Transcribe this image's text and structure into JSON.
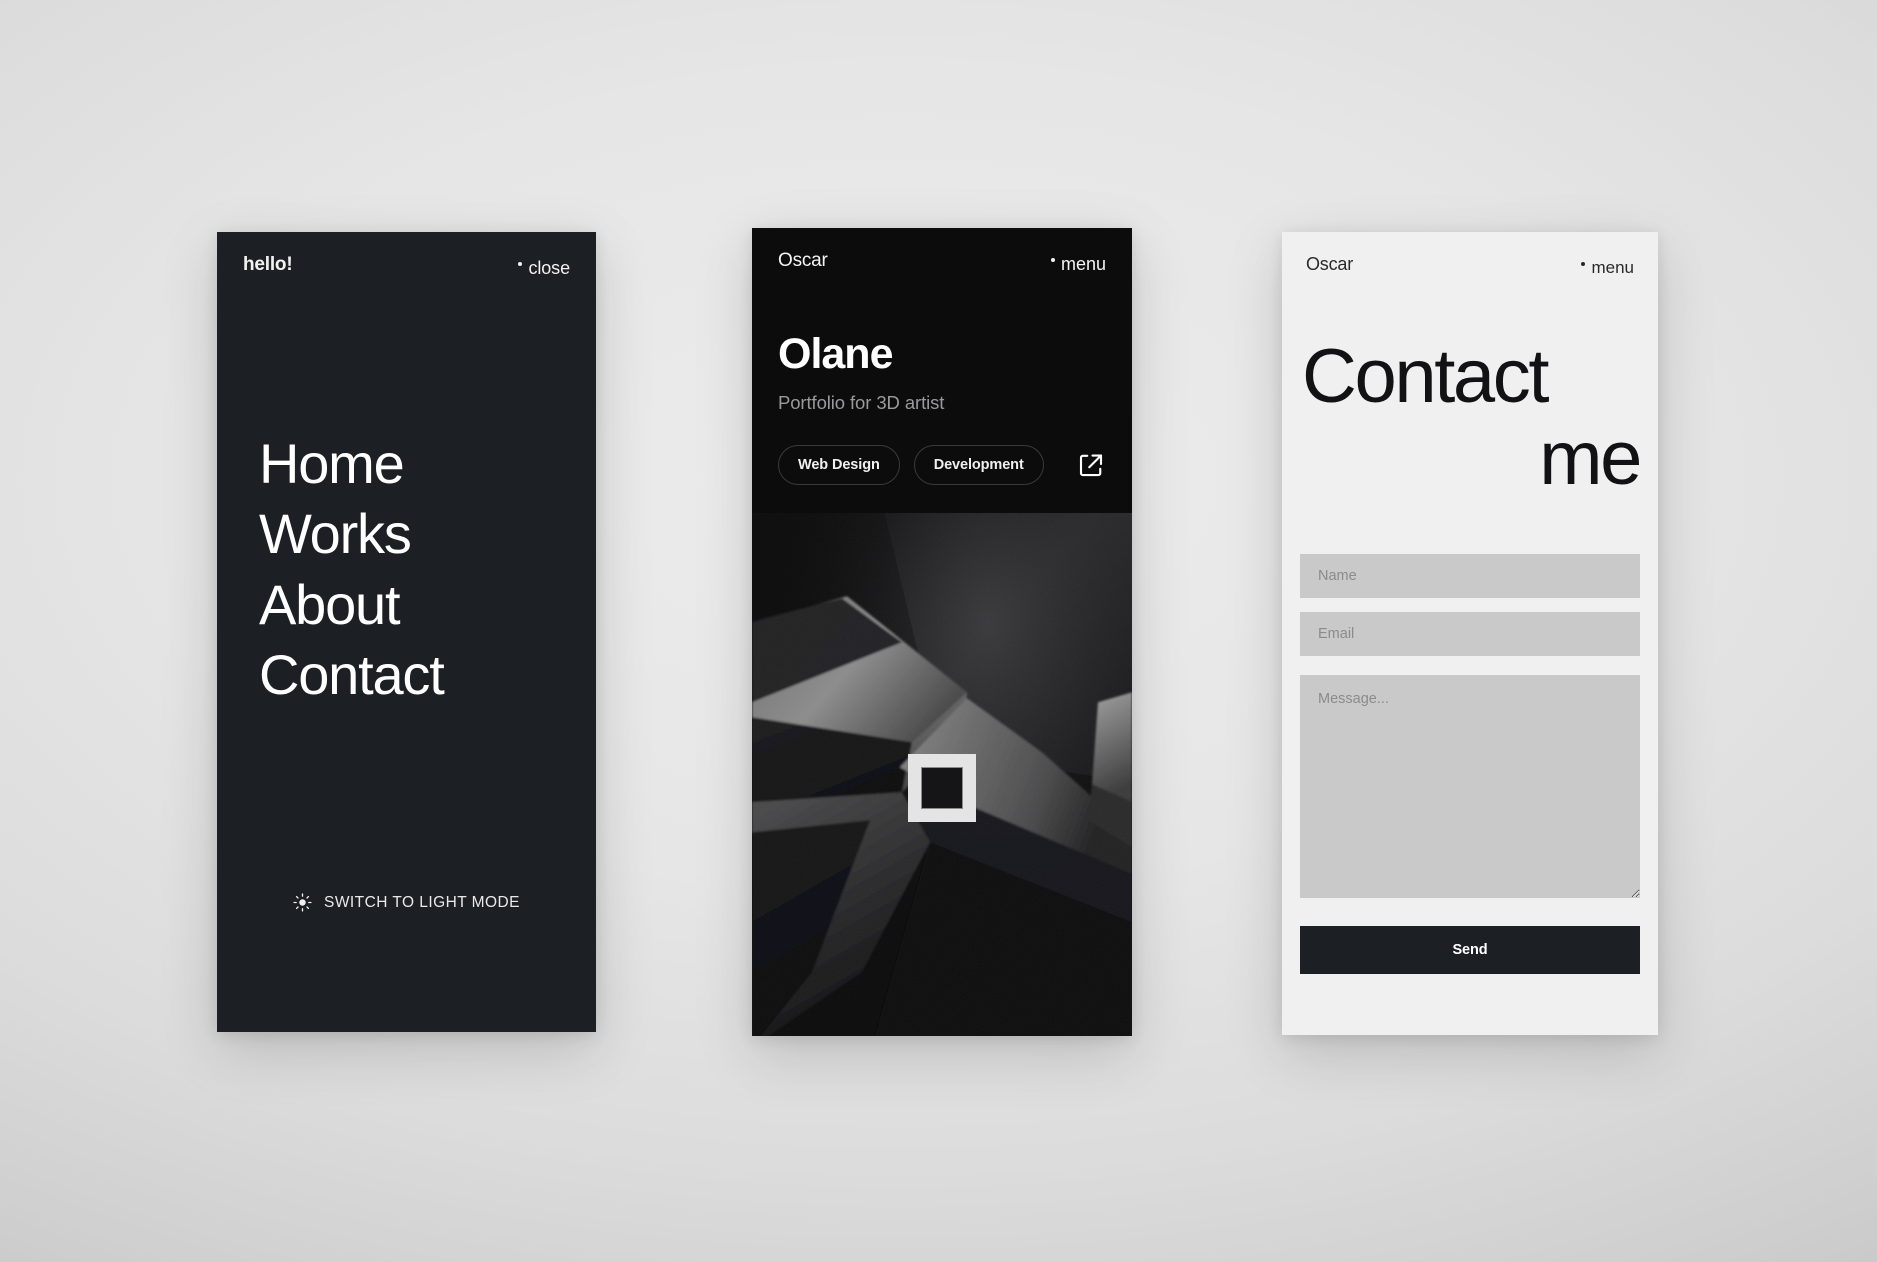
{
  "background": {
    "base_color": "#e6e6e6",
    "edge_color": "#c6c6c6"
  },
  "screens": [
    {
      "id": "menu",
      "theme": "dark",
      "background_color": "#1c1f23",
      "topbar": {
        "brand": "hello!",
        "action": "close",
        "bullet": "•"
      },
      "nav_items": [
        {
          "label": "Home"
        },
        {
          "label": "Works"
        },
        {
          "label": "About"
        },
        {
          "label": "Contact"
        }
      ],
      "theme_toggle": {
        "icon": "sun-icon",
        "label": "SWITCH TO LIGHT MODE"
      }
    },
    {
      "id": "project",
      "theme": "dark",
      "background_color": "#0c0c0d",
      "topbar": {
        "brand": "Oscar",
        "action": "menu",
        "bullet": "•"
      },
      "title": "Olane",
      "subtitle": "Portfolio for 3D artist",
      "tags": [
        {
          "label": "Web Design"
        },
        {
          "label": "Development"
        }
      ],
      "external_link_icon": "external-link-icon",
      "media": {
        "type": "3d-render",
        "description": "abstract dark geometric 3D render",
        "overlay_control": "square-frame-button"
      }
    },
    {
      "id": "contact",
      "theme": "light",
      "background_color": "#f0f0f0",
      "topbar": {
        "brand": "Oscar",
        "action": "menu",
        "bullet": "•"
      },
      "title_line_1": "Contact",
      "title_line_2": "me",
      "form": {
        "name_placeholder": "Name",
        "name_value": "",
        "email_placeholder": "Email",
        "email_value": "",
        "message_placeholder": "Message...",
        "message_value": "",
        "submit_label": "Send",
        "submit_color": "#1c1f23"
      }
    }
  ]
}
